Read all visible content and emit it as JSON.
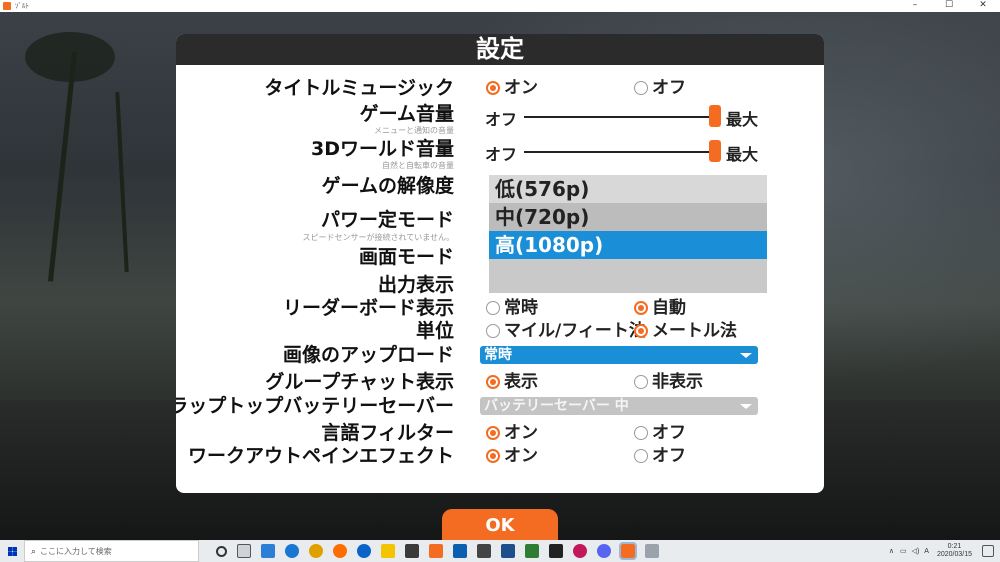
{
  "window": {
    "title": "ｿﾞﾙﾄ",
    "app_icon": "zwift-icon"
  },
  "dialog": {
    "title": "設定",
    "rows": {
      "title_music": {
        "label": "タイトルミュージック",
        "on": "オン",
        "off": "オフ",
        "selected": "on"
      },
      "game_volume": {
        "label": "ゲーム音量",
        "sub": "メニューと通知の音量",
        "min": "オフ",
        "max": "最大",
        "level": 1.0
      },
      "world_volume": {
        "label_prefix": "3D",
        "label": "ワールド音量",
        "sub": "自然と自転車の音量",
        "min": "オフ",
        "max": "最大",
        "level": 1.0
      },
      "resolution": {
        "label": "ゲームの解像度"
      },
      "power_mode": {
        "label": "パワー定モード",
        "sub": "スピードセンサーが接続されていません。"
      },
      "screen_mode": {
        "label": "画面モード"
      },
      "output_display": {
        "label": "出力表示"
      },
      "leaderboard": {
        "label": "リーダーボード表示",
        "opt1": "常時",
        "opt2": "自動",
        "selected": "opt2"
      },
      "units": {
        "label": "単位",
        "opt1": "マイル/フィート法",
        "opt2": "メートル法",
        "selected": "opt2"
      },
      "image_upload": {
        "label": "画像のアップロード",
        "value": "常時"
      },
      "group_chat": {
        "label": "グループチャット表示",
        "opt1": "表示",
        "opt2": "非表示",
        "selected": "opt1"
      },
      "battery_saver": {
        "label": "ラップトップバッテリーセーバー",
        "value": "バッテリーセーバー 中"
      },
      "language_filter": {
        "label": "言語フィルター",
        "on": "オン",
        "off": "オフ",
        "selected": "on"
      },
      "workout_pain": {
        "label": "ワークアウトペインエフェクト",
        "on": "オン",
        "off": "オフ",
        "selected": "on"
      }
    },
    "resolution_options": [
      "低(576p)",
      "中(720p)",
      "高(1080p)"
    ],
    "resolution_selected": "高(1080p)",
    "ok_label": "OK"
  },
  "colors": {
    "accent": "#f36c21",
    "select_blue": "#1a8ed6",
    "header": "#2b2b2b"
  },
  "taskbar": {
    "search_placeholder": "ここに入力して検索",
    "clock_time": "0:21",
    "clock_date": "2020/03/15",
    "ime": "A"
  }
}
